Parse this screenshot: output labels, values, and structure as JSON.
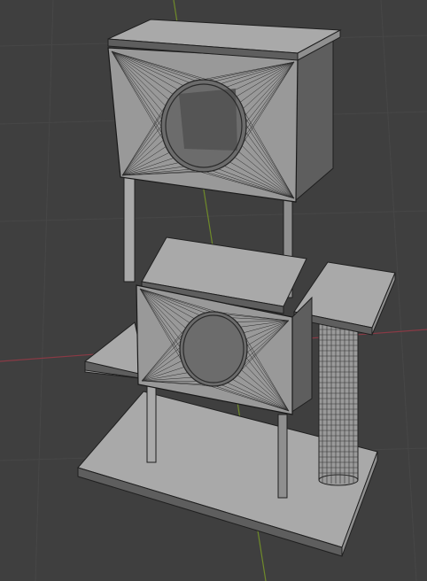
{
  "viewport": {
    "type": "3d-viewport",
    "shading": "solid-wireframe-overlay",
    "colors": {
      "background": "#3f3f3f",
      "grid": "#474747",
      "x_axis": "#8a3a45",
      "y_axis": "#6f8a2a",
      "model": "#a0a0a0"
    }
  },
  "scene": {
    "object": "cat-tree-model",
    "parts": [
      "base-plate",
      "left-leg",
      "right-leg",
      "lower-box",
      "middle-shelf",
      "left-step-platform",
      "right-step-platform",
      "scratching-post",
      "upper-box",
      "top-lid"
    ]
  }
}
